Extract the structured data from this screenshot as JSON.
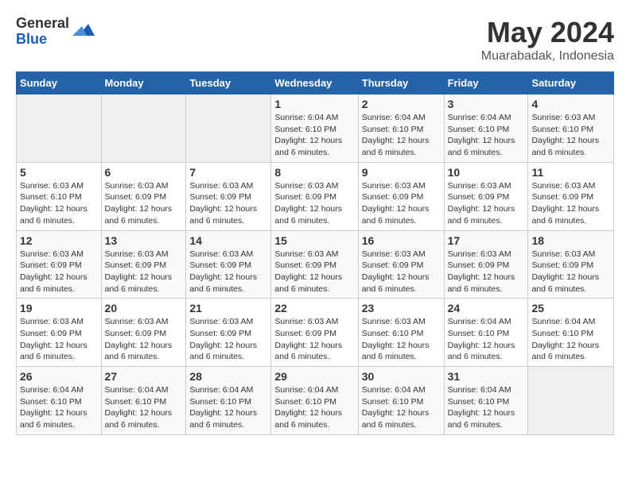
{
  "logo": {
    "general": "General",
    "blue": "Blue"
  },
  "title": {
    "month_year": "May 2024",
    "location": "Muarabadak, Indonesia"
  },
  "days_of_week": [
    "Sunday",
    "Monday",
    "Tuesday",
    "Wednesday",
    "Thursday",
    "Friday",
    "Saturday"
  ],
  "weeks": [
    [
      {
        "day": "",
        "info": ""
      },
      {
        "day": "",
        "info": ""
      },
      {
        "day": "",
        "info": ""
      },
      {
        "day": "1",
        "info": "Sunrise: 6:04 AM\nSunset: 6:10 PM\nDaylight: 12 hours\nand 6 minutes."
      },
      {
        "day": "2",
        "info": "Sunrise: 6:04 AM\nSunset: 6:10 PM\nDaylight: 12 hours\nand 6 minutes."
      },
      {
        "day": "3",
        "info": "Sunrise: 6:04 AM\nSunset: 6:10 PM\nDaylight: 12 hours\nand 6 minutes."
      },
      {
        "day": "4",
        "info": "Sunrise: 6:03 AM\nSunset: 6:10 PM\nDaylight: 12 hours\nand 6 minutes."
      }
    ],
    [
      {
        "day": "5",
        "info": "Sunrise: 6:03 AM\nSunset: 6:10 PM\nDaylight: 12 hours\nand 6 minutes."
      },
      {
        "day": "6",
        "info": "Sunrise: 6:03 AM\nSunset: 6:09 PM\nDaylight: 12 hours\nand 6 minutes."
      },
      {
        "day": "7",
        "info": "Sunrise: 6:03 AM\nSunset: 6:09 PM\nDaylight: 12 hours\nand 6 minutes."
      },
      {
        "day": "8",
        "info": "Sunrise: 6:03 AM\nSunset: 6:09 PM\nDaylight: 12 hours\nand 6 minutes."
      },
      {
        "day": "9",
        "info": "Sunrise: 6:03 AM\nSunset: 6:09 PM\nDaylight: 12 hours\nand 6 minutes."
      },
      {
        "day": "10",
        "info": "Sunrise: 6:03 AM\nSunset: 6:09 PM\nDaylight: 12 hours\nand 6 minutes."
      },
      {
        "day": "11",
        "info": "Sunrise: 6:03 AM\nSunset: 6:09 PM\nDaylight: 12 hours\nand 6 minutes."
      }
    ],
    [
      {
        "day": "12",
        "info": "Sunrise: 6:03 AM\nSunset: 6:09 PM\nDaylight: 12 hours\nand 6 minutes."
      },
      {
        "day": "13",
        "info": "Sunrise: 6:03 AM\nSunset: 6:09 PM\nDaylight: 12 hours\nand 6 minutes."
      },
      {
        "day": "14",
        "info": "Sunrise: 6:03 AM\nSunset: 6:09 PM\nDaylight: 12 hours\nand 6 minutes."
      },
      {
        "day": "15",
        "info": "Sunrise: 6:03 AM\nSunset: 6:09 PM\nDaylight: 12 hours\nand 6 minutes."
      },
      {
        "day": "16",
        "info": "Sunrise: 6:03 AM\nSunset: 6:09 PM\nDaylight: 12 hours\nand 6 minutes."
      },
      {
        "day": "17",
        "info": "Sunrise: 6:03 AM\nSunset: 6:09 PM\nDaylight: 12 hours\nand 6 minutes."
      },
      {
        "day": "18",
        "info": "Sunrise: 6:03 AM\nSunset: 6:09 PM\nDaylight: 12 hours\nand 6 minutes."
      }
    ],
    [
      {
        "day": "19",
        "info": "Sunrise: 6:03 AM\nSunset: 6:09 PM\nDaylight: 12 hours\nand 6 minutes."
      },
      {
        "day": "20",
        "info": "Sunrise: 6:03 AM\nSunset: 6:09 PM\nDaylight: 12 hours\nand 6 minutes."
      },
      {
        "day": "21",
        "info": "Sunrise: 6:03 AM\nSunset: 6:09 PM\nDaylight: 12 hours\nand 6 minutes."
      },
      {
        "day": "22",
        "info": "Sunrise: 6:03 AM\nSunset: 6:09 PM\nDaylight: 12 hours\nand 6 minutes."
      },
      {
        "day": "23",
        "info": "Sunrise: 6:03 AM\nSunset: 6:10 PM\nDaylight: 12 hours\nand 6 minutes."
      },
      {
        "day": "24",
        "info": "Sunrise: 6:04 AM\nSunset: 6:10 PM\nDaylight: 12 hours\nand 6 minutes."
      },
      {
        "day": "25",
        "info": "Sunrise: 6:04 AM\nSunset: 6:10 PM\nDaylight: 12 hours\nand 6 minutes."
      }
    ],
    [
      {
        "day": "26",
        "info": "Sunrise: 6:04 AM\nSunset: 6:10 PM\nDaylight: 12 hours\nand 6 minutes."
      },
      {
        "day": "27",
        "info": "Sunrise: 6:04 AM\nSunset: 6:10 PM\nDaylight: 12 hours\nand 6 minutes."
      },
      {
        "day": "28",
        "info": "Sunrise: 6:04 AM\nSunset: 6:10 PM\nDaylight: 12 hours\nand 6 minutes."
      },
      {
        "day": "29",
        "info": "Sunrise: 6:04 AM\nSunset: 6:10 PM\nDaylight: 12 hours\nand 6 minutes."
      },
      {
        "day": "30",
        "info": "Sunrise: 6:04 AM\nSunset: 6:10 PM\nDaylight: 12 hours\nand 6 minutes."
      },
      {
        "day": "31",
        "info": "Sunrise: 6:04 AM\nSunset: 6:10 PM\nDaylight: 12 hours\nand 6 minutes."
      },
      {
        "day": "",
        "info": ""
      }
    ]
  ]
}
